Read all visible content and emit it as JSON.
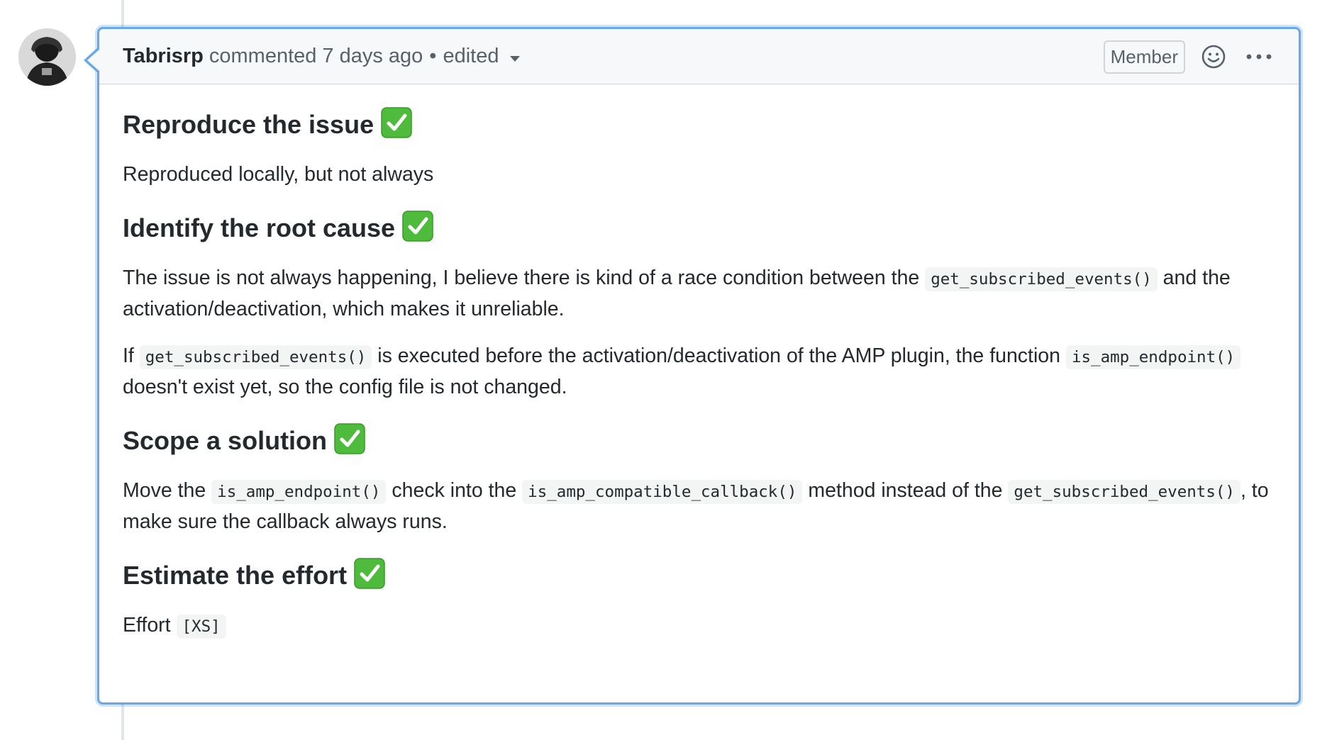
{
  "comment": {
    "author": "Tabrisrp",
    "action": "commented",
    "time": "7 days ago",
    "bullet": "•",
    "edited": "edited",
    "badge": "Member"
  },
  "body": {
    "section1": {
      "heading": "Reproduce the issue",
      "text": "Reproduced locally, but not always"
    },
    "section2": {
      "heading": "Identify the root cause",
      "p1_a": "The issue is not always happening, I believe there is kind of a race condition between the ",
      "p1_code": "get_subscribed_events()",
      "p1_b": " and the activation/deactivation, which makes it unreliable.",
      "p2_a": "If ",
      "p2_code1": "get_subscribed_events()",
      "p2_b": " is executed before the activation/deactivation of the AMP plugin, the function ",
      "p2_code2": "is_amp_endpoint()",
      "p2_c": " doesn't exist yet, so the config file is not changed."
    },
    "section3": {
      "heading": "Scope a solution",
      "p_a": "Move the ",
      "p_code1": "is_amp_endpoint()",
      "p_b": " check into the ",
      "p_code2": "is_amp_compatible_callback()",
      "p_c": " method instead of the ",
      "p_code3": "get_subscribed_events()",
      "p_d": ", to make sure the callback always runs."
    },
    "section4": {
      "heading": "Estimate the effort",
      "p_a": "Effort ",
      "p_code": "[XS]"
    }
  },
  "icons": {
    "check": "white-check-mark-icon",
    "emoji": "smiley-icon",
    "more": "kebab-horizontal-icon",
    "caret": "caret-down-icon"
  },
  "colors": {
    "focus_border": "#66a8e8",
    "header_bg": "#f6f8fa",
    "check_green": "#4fbb3c",
    "text": "#24292e",
    "muted": "#586069"
  }
}
